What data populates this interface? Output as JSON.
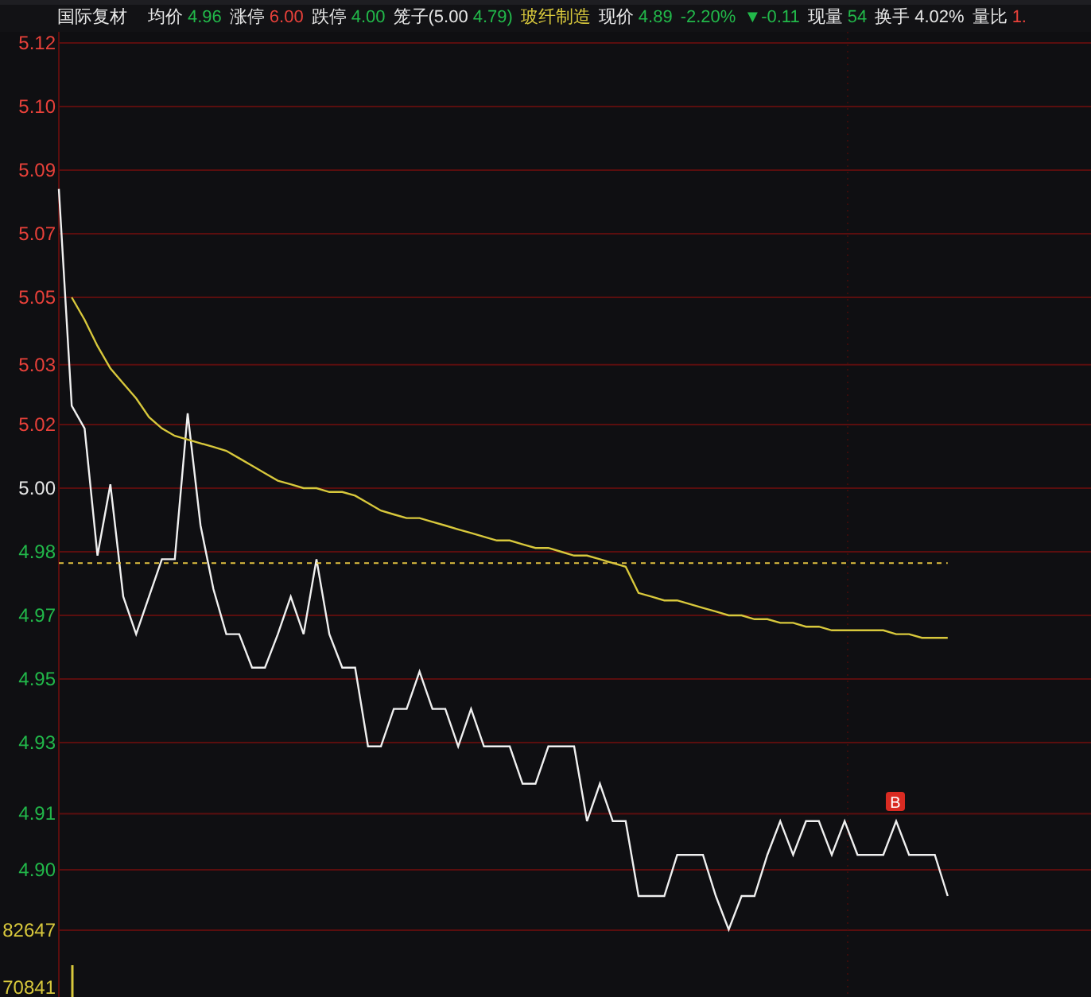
{
  "header": {
    "items": [
      {
        "kind": "name",
        "value": "国际复材"
      },
      {
        "kind": "field",
        "label": "均价",
        "value": "4.96",
        "color": "#22b84a"
      },
      {
        "kind": "field",
        "label": "涨停",
        "value": "6.00",
        "color": "#e8413a"
      },
      {
        "kind": "field",
        "label": "跌停",
        "value": "4.00",
        "color": "#22b84a"
      },
      {
        "kind": "field",
        "label": "笼子(5.00",
        "value": "4.79)",
        "color": "#22b84a"
      },
      {
        "kind": "sector",
        "value": "玻纤制造"
      },
      {
        "kind": "field",
        "label": "现价",
        "value": "4.89",
        "color": "#22b84a"
      },
      {
        "kind": "field",
        "value": "-2.20%",
        "color": "#22b84a"
      },
      {
        "kind": "field",
        "value": "▼-0.11",
        "color": "#22b84a"
      },
      {
        "kind": "field",
        "label": "现量",
        "value": "54",
        "color": "#22b84a"
      },
      {
        "kind": "field",
        "label": "换手",
        "value": "4.02%",
        "color": "#e6e6e6"
      },
      {
        "kind": "field",
        "label": "量比",
        "value": "1.",
        "color": "#e8413a"
      }
    ]
  },
  "price_axis_labels": [
    {
      "color": "#e8413a"
    },
    {
      "color": "#e8413a"
    },
    {
      "color": "#e8413a"
    },
    {
      "color": "#e8413a"
    },
    {
      "color": "#e8413a"
    },
    {
      "color": "#e8413a"
    },
    {
      "color": "#e8413a"
    },
    {
      "color": "#e6e6e6"
    },
    {
      "color": "#22b84a"
    },
    {
      "color": "#22b84a"
    },
    {
      "color": "#22b84a"
    },
    {
      "color": "#22b84a"
    },
    {
      "color": "#22b84a"
    },
    {
      "color": "#22b84a"
    }
  ],
  "chart_data": {
    "type": "line",
    "ylim": [
      4.865,
      5.12
    ],
    "categories": [
      null,
      null,
      null,
      null,
      null,
      null,
      null,
      null,
      null,
      null,
      null,
      null,
      null,
      null,
      null,
      null,
      null,
      null,
      null,
      null,
      null,
      null,
      null,
      null,
      null,
      null,
      null,
      null,
      null,
      null,
      null,
      null,
      null,
      null,
      null,
      null,
      null,
      null,
      null,
      null,
      null,
      null,
      null,
      null,
      null,
      null,
      null,
      null,
      null,
      null,
      null,
      null,
      null,
      null,
      null,
      null,
      null,
      null,
      null,
      null,
      null,
      null,
      null,
      null,
      null,
      null,
      null,
      null,
      null,
      null
    ],
    "yticks": [
      {
        "value": 5.12,
        "label": "5.12"
      },
      {
        "value": 5.103,
        "label": "5.10"
      },
      {
        "value": 5.086,
        "label": "5.09"
      },
      {
        "value": 5.069,
        "label": "5.07"
      },
      {
        "value": 5.052,
        "label": "5.05"
      },
      {
        "value": 5.034,
        "label": "5.03"
      },
      {
        "value": 5.018,
        "label": "5.02"
      },
      {
        "value": 5.001,
        "label": "5.00"
      },
      {
        "value": 4.984,
        "label": "4.98"
      },
      {
        "value": 4.967,
        "label": "4.97"
      },
      {
        "value": 4.95,
        "label": "4.95"
      },
      {
        "value": 4.933,
        "label": "4.93"
      },
      {
        "value": 4.914,
        "label": "4.91"
      },
      {
        "value": 4.899,
        "label": "4.90"
      }
    ],
    "series": [
      {
        "color": "#f0f0f0",
        "values": [
          5.081,
          5.023,
          5.017,
          4.983,
          5.002,
          4.972,
          4.962,
          4.972,
          4.982,
          4.982,
          5.021,
          4.991,
          4.974,
          4.962,
          4.962,
          4.953,
          4.953,
          4.962,
          4.972,
          4.962,
          4.982,
          4.962,
          4.953,
          4.953,
          4.932,
          4.932,
          4.942,
          4.942,
          4.952,
          4.942,
          4.942,
          4.932,
          4.942,
          4.932,
          4.932,
          4.932,
          4.922,
          4.922,
          4.932,
          4.932,
          4.932,
          4.912,
          4.922,
          4.912,
          4.912,
          4.892,
          4.892,
          4.892,
          4.903,
          4.903,
          4.903,
          4.892,
          4.883,
          4.892,
          4.892,
          4.903,
          4.912,
          4.903,
          4.912,
          4.912,
          4.903,
          4.912,
          4.903,
          4.903,
          4.903,
          4.912,
          4.903,
          4.903,
          4.903,
          4.892
        ]
      },
      {
        "color": "#d8c83c",
        "values": [
          null,
          5.052,
          5.046,
          5.039,
          5.033,
          5.029,
          5.025,
          5.02,
          5.017,
          5.015,
          5.014,
          5.013,
          5.012,
          5.011,
          5.009,
          5.007,
          5.005,
          5.003,
          5.002,
          5.001,
          5.001,
          5.0,
          5.0,
          4.999,
          4.997,
          4.995,
          4.994,
          4.993,
          4.993,
          4.992,
          4.991,
          4.99,
          4.989,
          4.988,
          4.987,
          4.987,
          4.986,
          4.985,
          4.985,
          4.984,
          4.983,
          4.983,
          4.982,
          4.981,
          4.98,
          4.973,
          4.972,
          4.971,
          4.971,
          4.97,
          4.969,
          4.968,
          4.967,
          4.967,
          4.966,
          4.966,
          4.965,
          4.965,
          4.964,
          4.964,
          4.963,
          4.963,
          4.963,
          4.963,
          4.963,
          4.962,
          4.962,
          4.961,
          4.961,
          4.961
        ]
      },
      {
        "color": "#e0c040",
        "line_style": "dashed",
        "values": [
          4.981,
          4.981,
          4.981,
          4.981,
          4.981,
          4.981,
          4.981,
          4.981,
          4.981,
          4.981,
          4.981,
          4.981,
          4.981,
          4.981,
          4.981,
          4.981,
          4.981,
          4.981,
          4.981,
          4.981,
          4.981,
          4.981,
          4.981,
          4.981,
          4.981,
          4.981,
          4.981,
          4.981,
          4.981,
          4.981,
          4.981,
          4.981,
          4.981,
          4.981,
          4.981,
          4.981,
          4.981,
          4.981,
          4.981,
          4.981,
          4.981,
          4.981,
          4.981,
          4.981,
          4.981,
          4.981,
          4.981,
          4.981,
          4.981,
          4.981,
          4.981,
          4.981,
          4.981,
          4.981,
          4.981,
          4.981,
          4.981,
          4.981,
          4.981,
          4.981,
          4.981,
          4.981,
          4.981,
          4.981,
          4.981,
          4.981,
          4.981,
          4.981,
          4.981,
          4.981
        ]
      }
    ],
    "grid": true
  },
  "signals": [
    {
      "label": "B"
    }
  ],
  "volume": {
    "labels": [
      "82647",
      "70841"
    ]
  }
}
